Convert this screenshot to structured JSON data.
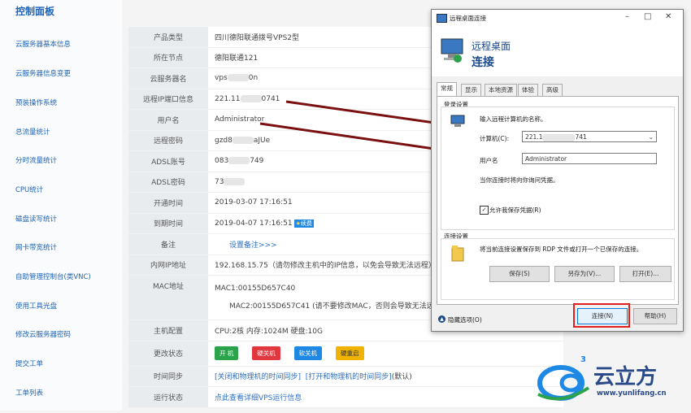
{
  "sidebar": {
    "title": "控制面板",
    "items": [
      "云服务器基本信息",
      "云服务器信息变更",
      "预装操作系统",
      "总流量统计",
      "分时流量统计",
      "CPU统计",
      "磁盘读写统计",
      "网卡带宽统计",
      "自助管理控制台(类VNC)",
      "使用工具光盘",
      "修改云服务器密码",
      "提交工单",
      "工单列表"
    ]
  },
  "info": {
    "product_type": {
      "label": "产品类型",
      "value": "四川德阳联通拨号VPS2型"
    },
    "node": {
      "label": "所在节点",
      "value": "德阳联通121"
    },
    "server_name": {
      "label": "云服务器名",
      "value_a": "vps",
      "value_b": "0n"
    },
    "remote": {
      "label": "远程IP端口信息",
      "value_a": "221.11",
      "value_b": "0741"
    },
    "username": {
      "label": "用户名",
      "value": "Administrator"
    },
    "password": {
      "label": "远程密码",
      "value_a": "gzd8",
      "value_b": "aJUe"
    },
    "adsl_account": {
      "label": "ADSL账号",
      "value_a": "083",
      "value_b": "749"
    },
    "adsl_password": {
      "label": "ADSL密码",
      "value_a": "73"
    },
    "open_time": {
      "label": "开通时间",
      "value": "2019-03-07 17:16:51"
    },
    "expire_time": {
      "label": "到期时间",
      "value": "2019-04-07 17:16:51",
      "badge": "续费"
    },
    "remark": {
      "label": "备注",
      "link": "设置备注>>>"
    },
    "lan_ip": {
      "label": "内网IP地址",
      "value": "192.168.15.75（请勿修改主机中的IP信息，以免会导致无法远程）"
    },
    "mac": {
      "label": "MAC地址",
      "mac1": "MAC1:00155D657C40",
      "mac2": "MAC2:00155D657C41 (请不要修改MAC，否则会导致无法远程"
    },
    "config": {
      "label": "主机配置",
      "value": "CPU:2核 内存:1024M 硬盘:10G"
    },
    "state_change": {
      "label": "更改状态",
      "buttons": [
        "开 机",
        "硬关机",
        "软关机",
        "硬重启"
      ]
    },
    "time_sync": {
      "label": "时间同步",
      "link1": "[关闭和物理机的时间同步]",
      "link2": "[打开和物理机的时间同步]",
      "suffix": "(默认)"
    },
    "run_status": {
      "label": "运行状态",
      "link": "点此查看详细VPS运行信息"
    }
  },
  "colors": {
    "accent": "#1e63b5",
    "start": "#2aa34a",
    "hard_off": "#e0383e",
    "soft_off": "#1e88e5",
    "hard_reboot": "#f0b400",
    "arrow": "#7a1010",
    "highlight": "#e02020"
  },
  "dialog": {
    "title": "远程桌面连接",
    "header_line1": "远程桌面",
    "header_line2": "连接",
    "tabs": [
      "常规",
      "显示",
      "本地资源",
      "体验",
      "高级"
    ],
    "login_group": "登录设置",
    "enter_prompt": "输入远程计算机的名称。",
    "computer_label": "计算机(C):",
    "computer_value_a": "221.1",
    "computer_value_b": "741",
    "user_label": "用户名",
    "user_value": "Administrator",
    "cred_note": "当你连接时将向你询问凭据。",
    "save_cred": "允许我保存凭据(R)",
    "conn_group": "连接设置",
    "conn_note": "将当前连接设置保存到 RDP 文件或打开一个已保存的连接。",
    "save_btn": "保存(S)",
    "saveas_btn": "另存为(V)...",
    "open_btn": "打开(E)...",
    "hide_options": "隐藏选项(O)",
    "connect_btn": "连接(N)",
    "help_btn": "帮助(H)"
  },
  "brand": {
    "name": "云立方",
    "url": "www.yunlifang.cn",
    "sup": "3"
  }
}
